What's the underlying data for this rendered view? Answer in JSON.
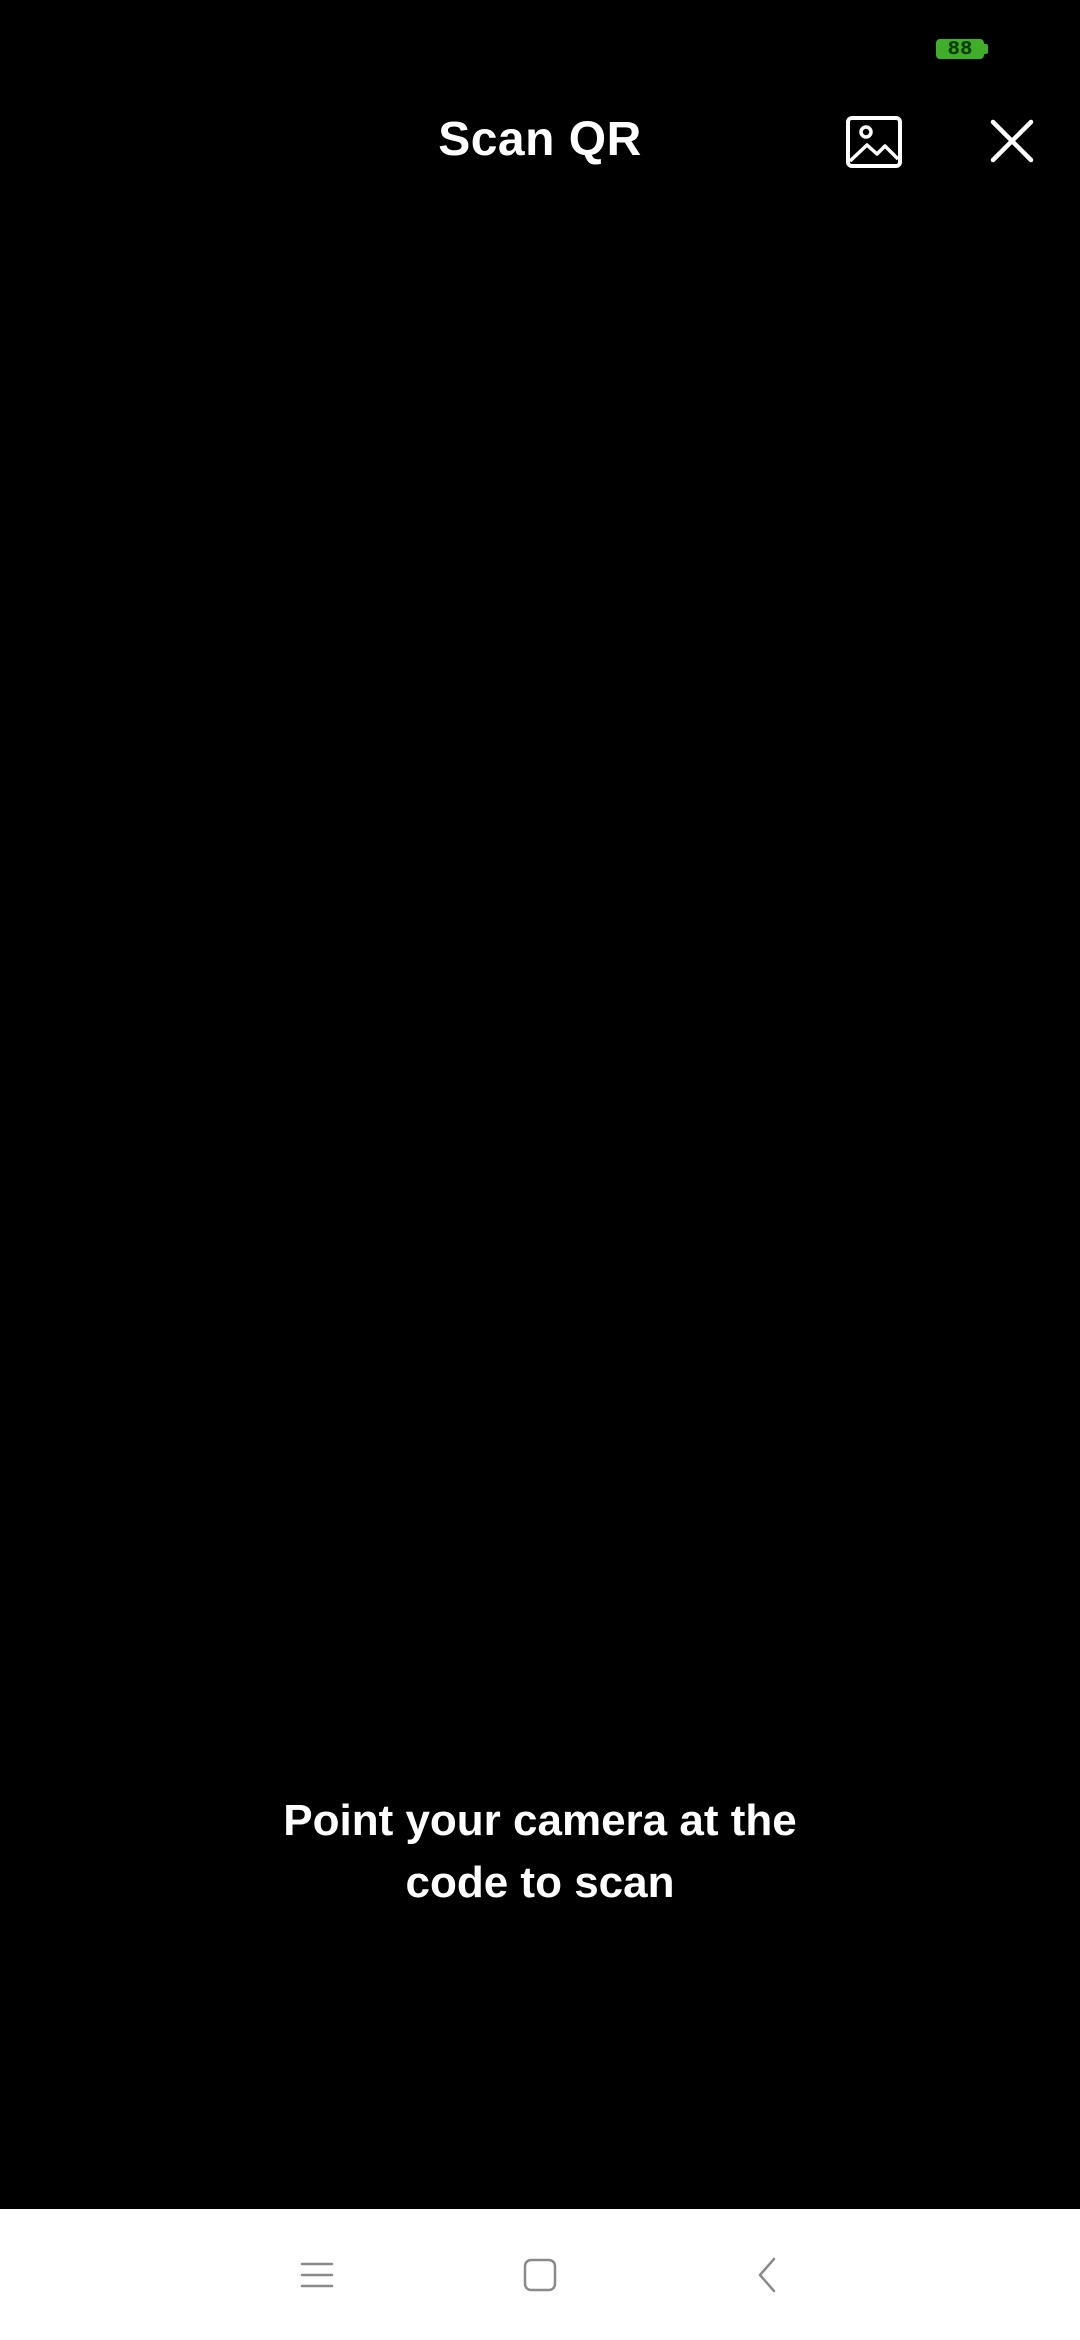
{
  "status_bar": {
    "battery_level": "88",
    "battery_color": "#3fae29"
  },
  "header": {
    "title": "Scan QR",
    "gallery_icon": "image-icon",
    "close_icon": "close-icon"
  },
  "viewfinder": {
    "hint_line1": "Point your camera at the",
    "hint_line2": "code to scan"
  },
  "nav_bar": {
    "menu_icon": "menu-icon",
    "home_icon": "home-icon",
    "back_icon": "back-icon"
  },
  "colors": {
    "background": "#000000",
    "text": "#ffffff",
    "nav_background": "#ffffff",
    "nav_icon": "#8a8a8a"
  }
}
